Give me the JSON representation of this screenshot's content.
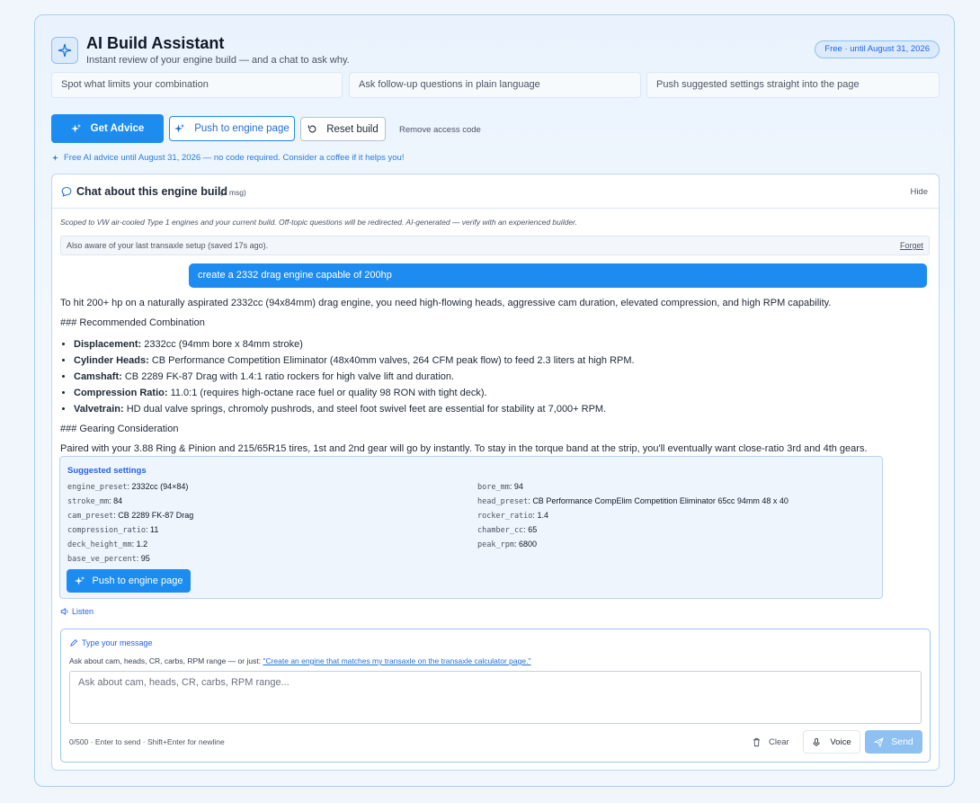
{
  "header": {
    "title": "AI Build Assistant",
    "subtitle": "Instant review of your engine build — and a chat to ask why.",
    "badge": "Free · until August 31, 2026"
  },
  "features": [
    "Spot what limits your combination",
    "Ask follow-up questions in plain language",
    "Push suggested settings straight into the page"
  ],
  "actions": {
    "get_advice": "Get Advice",
    "push": "Push to engine page",
    "reset": "Reset build",
    "remove_code": "Remove access code"
  },
  "free_note": "Free AI advice until August 31, 2026 — no code required. Consider a coffee if it helps you!",
  "chat": {
    "title": "Chat about this engine build",
    "count": "(2 msg)",
    "hide": "Hide",
    "scope": "Scoped to VW air-cooled Type 1 engines and your current build. Off-topic questions will be redirected. AI-generated — verify with an experienced builder.",
    "aware": "Also aware of your last transaxle setup (saved 17s ago).",
    "forget": "Forget",
    "user_message": "create a 2332 drag engine capable of 200hp",
    "reply": {
      "intro": "To hit 200+ hp on a naturally aspirated 2332cc (94x84mm) drag engine, you need high-flowing heads, aggressive cam duration, elevated compression, and high RPM capability.",
      "h1": "### Recommended Combination",
      "items": [
        {
          "label": "Displacement:",
          "text": "2332cc (94mm bore x 84mm stroke)"
        },
        {
          "label": "Cylinder Heads:",
          "text": "CB Performance Competition Eliminator (48x40mm valves, 264 CFM peak flow) to feed 2.3 liters at high RPM."
        },
        {
          "label": "Camshaft:",
          "text": "CB 2289 FK-87 Drag with 1.4:1 ratio rockers for high valve lift and duration."
        },
        {
          "label": "Compression Ratio:",
          "text": "11.0:1 (requires high-octane race fuel or quality 98 RON with tight deck)."
        },
        {
          "label": "Valvetrain:",
          "text": "HD dual valve springs, chromoly pushrods, and steel foot swivel feet are essential for stability at 7,000+ RPM."
        }
      ],
      "h2": "### Gearing Consideration",
      "outro": "Paired with your 3.88 Ring & Pinion and 215/65R15 tires, 1st and 2nd gear will go by instantly. To stay in the torque band at the strip, you'll eventually want close-ratio 3rd and 4th gears."
    },
    "suggested": {
      "title": "Suggested settings",
      "left": [
        {
          "k": "engine_preset",
          "v": "2332cc (94×84)"
        },
        {
          "k": "stroke_mm",
          "v": "84"
        },
        {
          "k": "cam_preset",
          "v": "CB 2289 FK-87 Drag"
        },
        {
          "k": "compression_ratio",
          "v": "11"
        },
        {
          "k": "deck_height_mm",
          "v": "1.2"
        },
        {
          "k": "base_ve_percent",
          "v": "95"
        }
      ],
      "right": [
        {
          "k": "bore_mm",
          "v": "94"
        },
        {
          "k": "head_preset",
          "v": "CB Performance CompElim Competition Eliminator 65cc 94mm 48 x 40"
        },
        {
          "k": "rocker_ratio",
          "v": "1.4"
        },
        {
          "k": "chamber_cc",
          "v": "65"
        },
        {
          "k": "peak_rpm",
          "v": "6800"
        }
      ],
      "push": "Push to engine page"
    },
    "listen": "Listen"
  },
  "composer": {
    "label": "Type your message",
    "hint": "Ask about cam, heads, CR, carbs, RPM range — or just:",
    "hint_link": "\"Create an engine that matches my transaxle on the transaxle calculator page.\"",
    "placeholder": "Ask about cam, heads, CR, carbs, RPM range...",
    "counter": "0/500 · Enter to send · Shift+Enter for newline",
    "clear": "Clear",
    "voice": "Voice",
    "send": "Send"
  }
}
